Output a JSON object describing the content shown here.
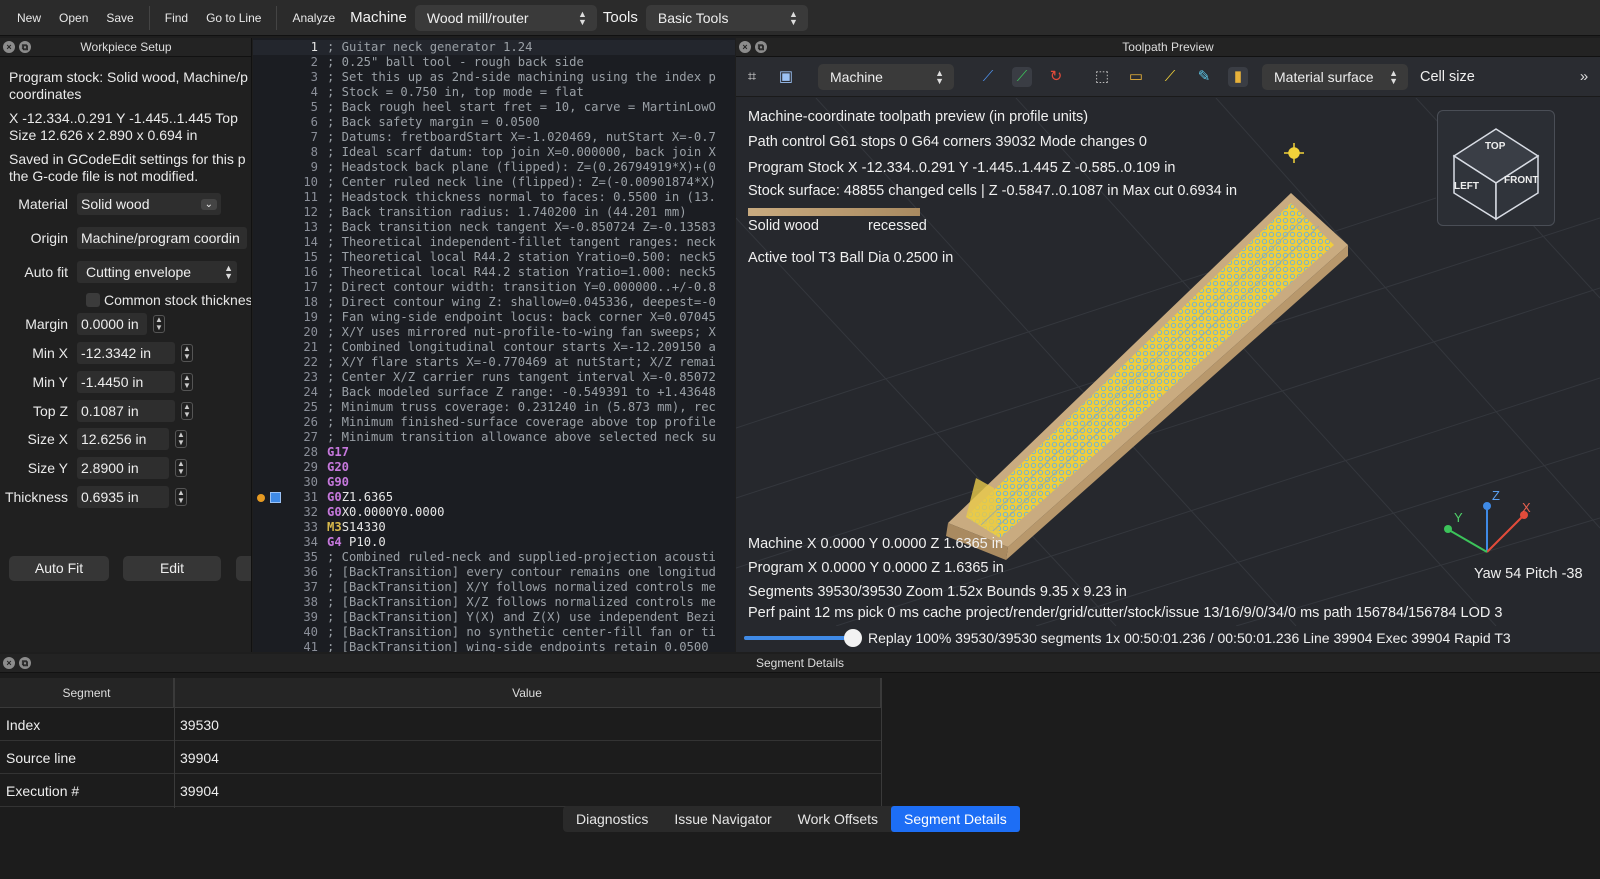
{
  "toolbar": {
    "new": "New",
    "open": "Open",
    "save": "Save",
    "find": "Find",
    "goto": "Go to Line",
    "analyze": "Analyze",
    "machine_label": "Machine",
    "machine_value": "Wood mill/router",
    "tools_label": "Tools",
    "tools_value": "Basic Tools"
  },
  "workpiece": {
    "title": "Workpiece Setup",
    "info1": "Program stock: Solid wood, Machine/p",
    "info1b": "coordinates",
    "info2": "X -12.334..0.291  Y -1.445..1.445  Top",
    "info3": "Size 12.626 x 2.890 x 0.694 in",
    "info4": "Saved in GCodeEdit settings for this p",
    "info5": "the G-code file is not modified.",
    "material_label": "Material",
    "material_value": "Solid wood",
    "origin_label": "Origin",
    "origin_value": "Machine/program coordin",
    "autofit_label": "Auto fit",
    "autofit_value": "Cutting envelope",
    "common_stock": "Common stock thicknes",
    "margin_label": "Margin",
    "margin_value": "0.0000 in",
    "minx_label": "Min X",
    "minx_value": "-12.3342 in",
    "miny_label": "Min Y",
    "miny_value": "-1.4450 in",
    "topz_label": "Top Z",
    "topz_value": "0.1087 in",
    "sizex_label": "Size X",
    "sizex_value": "12.6256 in",
    "sizey_label": "Size Y",
    "sizey_value": "2.8900 in",
    "thickness_label": "Thickness",
    "thickness_value": "0.6935 in",
    "autofit_button": "Auto Fit",
    "edit_button": "Edit"
  },
  "editor": {
    "lines": [
      {
        "n": "1",
        "t": "; Guitar neck generator 1.24"
      },
      {
        "n": "2",
        "t": "; 0.25\" ball tool - rough back side"
      },
      {
        "n": "3",
        "t": "; Set this up as 2nd-side machining using the index p"
      },
      {
        "n": "4",
        "t": "; Stock = 0.750 in, top mode = flat"
      },
      {
        "n": "5",
        "t": "; Back rough heel start fret = 10, carve = MartinLowO"
      },
      {
        "n": "6",
        "t": "; Back safety margin = 0.0500"
      },
      {
        "n": "7",
        "t": "; Datums: fretboardStart X=-1.020469, nutStart X=-0.7"
      },
      {
        "n": "8",
        "t": "; Ideal scarf datum: top join X=0.000000, back join X"
      },
      {
        "n": "9",
        "t": "; Headstock back plane (flipped): Z=(0.26794919*X)+(0"
      },
      {
        "n": "10",
        "t": "; Center ruled neck line (flipped): Z=(-0.00901874*X)"
      },
      {
        "n": "11",
        "t": "; Headstock thickness normal to faces: 0.5500 in (13."
      },
      {
        "n": "12",
        "t": "; Back transition radius: 1.740200 in (44.201 mm)"
      },
      {
        "n": "13",
        "t": "; Back transition neck tangent X=-0.850724 Z=-0.13583"
      },
      {
        "n": "14",
        "t": "; Theoretical independent-fillet tangent ranges: neck"
      },
      {
        "n": "15",
        "t": "; Theoretical local R44.2 station Yratio=0.500: neck5"
      },
      {
        "n": "16",
        "t": "; Theoretical local R44.2 station Yratio=1.000: neck5"
      },
      {
        "n": "17",
        "t": "; Direct contour width: transition Y=0.000000..+/-0.8"
      },
      {
        "n": "18",
        "t": "; Direct contour wing Z: shallow=0.045336, deepest=-0"
      },
      {
        "n": "19",
        "t": "; Fan wing-side endpoint locus: back corner X=0.07045"
      },
      {
        "n": "20",
        "t": "; X/Y uses mirrored nut-profile-to-wing fan sweeps; X"
      },
      {
        "n": "21",
        "t": "; Combined longitudinal contour starts X=-12.209150 a"
      },
      {
        "n": "22",
        "t": "; X/Y flare starts X=-0.770469 at nutStart; X/Z remai"
      },
      {
        "n": "23",
        "t": "; Center X/Z carrier runs tangent interval X=-0.85072"
      },
      {
        "n": "24",
        "t": "; Back modeled surface Z range: -0.549391 to +1.43648"
      },
      {
        "n": "25",
        "t": "; Minimum truss coverage: 0.231240 in (5.873 mm), rec"
      },
      {
        "n": "26",
        "t": "; Minimum finished-surface coverage above top profile"
      },
      {
        "n": "27",
        "t": "; Minimum transition allowance above selected neck su"
      },
      {
        "n": "28",
        "k": "G17",
        "r": ""
      },
      {
        "n": "29",
        "k": "G20",
        "r": ""
      },
      {
        "n": "30",
        "k": "G90",
        "r": ""
      },
      {
        "n": "31",
        "k": "G0",
        "r": "Z1.6365"
      },
      {
        "n": "32",
        "k": "G0",
        "r": "X0.0000Y0.0000"
      },
      {
        "n": "33",
        "k": "M3",
        "r": "S14330",
        "m": true
      },
      {
        "n": "34",
        "k": "G4",
        "r": " P10.0"
      },
      {
        "n": "35",
        "t": "; Combined ruled-neck and supplied-projection acousti"
      },
      {
        "n": "36",
        "t": "; [BackTransition] every contour remains one longitud"
      },
      {
        "n": "37",
        "t": "; [BackTransition] X/Y follows normalized controls me"
      },
      {
        "n": "38",
        "t": "; [BackTransition] X/Z follows normalized controls me"
      },
      {
        "n": "39",
        "t": "; [BackTransition] Y(X) and Z(X) use independent Bezi"
      },
      {
        "n": "40",
        "t": "; [BackTransition] no synthetic center-fill fan or ti"
      },
      {
        "n": "41",
        "t": "; [BackTransition] wing-side endpoints retain 0.0500"
      }
    ]
  },
  "preview": {
    "title": "Toolpath Preview",
    "view_select": "Machine",
    "surface_select": "Material surface",
    "cell_size": "Cell size",
    "info_header": "Machine-coordinate toolpath preview (in profile units)",
    "path_control": "Path control  G61 stops 0   G64 corners 39032   Mode changes 0",
    "program_stock": "Program Stock  X -12.334..0.291  Y -1.445..1.445  Z -0.585..0.109 in",
    "stock_surface": "Stock surface: 48855 changed cells   |   Z -0.5847..0.1087 in   Max cut 0.6934 in",
    "legend_solid": "Solid wood",
    "legend_recessed": "recessed",
    "active_tool": "Active tool T3     Ball    Dia 0.2500 in",
    "machine_pos": "Machine X 0.0000    Y 0.0000    Z 1.6365 in",
    "program_pos": "Program X 0.0000    Y 0.0000    Z 1.6365 in",
    "segments": "Segments 39530/39530    Zoom 1.52x    Bounds 9.35 x 9.23 in",
    "perf": "Perf paint 12 ms   pick 0 ms   cache project/render/grid/cutter/stock/issue 13/16/9/0/34/0 ms   path 156784/156784 LOD 3",
    "replay": "Replay 100%   39530/39530 segments   1x   00:50:01.236 / 00:50:01.236   Line 39904   Exec 39904   Rapid   T3",
    "replay_progress": 0.97,
    "yaw_pitch": "Yaw 54   Pitch -38",
    "cube_top": "TOP",
    "cube_left": "LEFT",
    "cube_front": "FRONT",
    "axis_x": "X",
    "axis_y": "Y",
    "axis_z": "Z"
  },
  "details": {
    "title": "Segment Details",
    "col_segment": "Segment",
    "col_value": "Value",
    "rows": [
      {
        "k": "Index",
        "v": "39530"
      },
      {
        "k": "Source line",
        "v": "39904"
      },
      {
        "k": "Execution #",
        "v": "39904"
      }
    ],
    "tabs": [
      "Diagnostics",
      "Issue Navigator",
      "Work Offsets",
      "Segment Details"
    ]
  }
}
